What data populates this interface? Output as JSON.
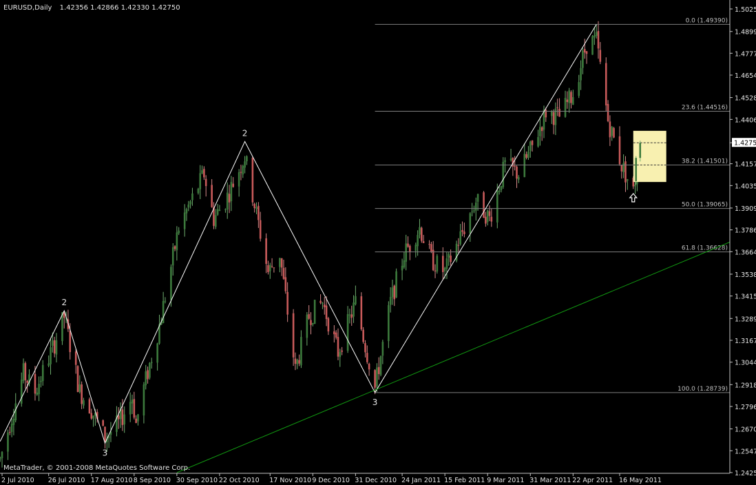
{
  "chart_data": {
    "type": "candlestick",
    "header": {
      "symbol": "EURUSD,Daily",
      "ohlc": "1.42356 1.42866 1.42330 1.42750"
    },
    "copyright": "MetaTrader, © 2001-2008 MetaQuotes Software Corp.",
    "ylim": [
      1.2425,
      1.5055
    ],
    "y_ticks": [
      "1.50255",
      "1.48990",
      "1.47770",
      "1.46545",
      "1.45285",
      "1.44060",
      "1.42750",
      "1.41575",
      "1.40350",
      "1.39090",
      "1.37865",
      "1.36640",
      "1.35380",
      "1.34155",
      "1.32895",
      "1.31670",
      "1.30445",
      "1.29185",
      "1.27960",
      "1.26700",
      "1.25475",
      "1.24250"
    ],
    "current_price": "1.42750",
    "x_ticks": [
      "2 Jul 2010",
      "26 Jul 2010",
      "17 Aug 2010",
      "8 Sep 2010",
      "30 Sep 2010",
      "22 Oct 2010",
      "17 Nov 2010",
      "9 Dec 2010",
      "31 Dec 2010",
      "24 Jan 2011",
      "15 Feb 2011",
      "9 Mar 2011",
      "31 Mar 2011",
      "22 Apr 2011",
      "16 May 2011"
    ],
    "fib_levels": [
      {
        "label": "0.0 (1.49390)",
        "value": 1.4939
      },
      {
        "label": "23.6 (1.44516)",
        "value": 1.44516
      },
      {
        "label": "38.2 (1.41501)",
        "value": 1.41501
      },
      {
        "label": "50.0 (1.39065)",
        "value": 1.39065
      },
      {
        "label": "61.8 (1.36628)",
        "value": 1.36628
      },
      {
        "label": "100.0 (1.28739)",
        "value": 1.28739
      }
    ],
    "zigzag": [
      {
        "date": "2010-07-01",
        "price": 1.26
      },
      {
        "date": "2010-08-03",
        "price": 1.3333
      },
      {
        "date": "2010-08-24",
        "price": 1.259
      },
      {
        "date": "2010-11-04",
        "price": 1.4282
      },
      {
        "date": "2011-01-10",
        "price": 1.2874
      },
      {
        "date": "2011-05-04",
        "price": 1.4939
      }
    ],
    "wave_labels": [
      {
        "text": "2",
        "date": "2010-08-03",
        "price": 1.3333,
        "pos": "above"
      },
      {
        "text": "3",
        "date": "2010-08-24",
        "price": 1.259,
        "pos": "below"
      },
      {
        "text": "2",
        "date": "2010-11-04",
        "price": 1.4282,
        "pos": "above"
      },
      {
        "text": "3",
        "date": "2011-01-10",
        "price": 1.2874,
        "pos": "below"
      }
    ],
    "trendline": {
      "from": {
        "date": "2010-09-30",
        "price": 1.2425
      },
      "to": {
        "date": "2011-06-14",
        "price": 1.3718
      }
    },
    "highlight_box": {
      "from_date": "2011-05-23",
      "to_date": "2011-06-09",
      "top": 1.4342,
      "bottom": 1.4055
    },
    "arrow": {
      "date": "2011-05-23",
      "price": 1.399
    },
    "candle_anchors": [
      {
        "date": "2010-07-01",
        "price": 1.25
      },
      {
        "date": "2010-07-13",
        "price": 1.298
      },
      {
        "date": "2010-07-19",
        "price": 1.288
      },
      {
        "date": "2010-07-29",
        "price": 1.315
      },
      {
        "date": "2010-08-03",
        "price": 1.33
      },
      {
        "date": "2010-08-11",
        "price": 1.288
      },
      {
        "date": "2010-08-16",
        "price": 1.28
      },
      {
        "date": "2010-08-24",
        "price": 1.262
      },
      {
        "date": "2010-08-31",
        "price": 1.27
      },
      {
        "date": "2010-09-07",
        "price": 1.285
      },
      {
        "date": "2010-09-09",
        "price": 1.27
      },
      {
        "date": "2010-09-13",
        "price": 1.29
      },
      {
        "date": "2010-09-21",
        "price": 1.325
      },
      {
        "date": "2010-10-01",
        "price": 1.38
      },
      {
        "date": "2010-10-14",
        "price": 1.41
      },
      {
        "date": "2010-10-19",
        "price": 1.385
      },
      {
        "date": "2010-10-25",
        "price": 1.395
      },
      {
        "date": "2010-11-04",
        "price": 1.42
      },
      {
        "date": "2010-11-16",
        "price": 1.355
      },
      {
        "date": "2010-11-22",
        "price": 1.365
      },
      {
        "date": "2010-11-30",
        "price": 1.3
      },
      {
        "date": "2010-12-07",
        "price": 1.33
      },
      {
        "date": "2010-12-14",
        "price": 1.338
      },
      {
        "date": "2010-12-22",
        "price": 1.31
      },
      {
        "date": "2010-12-31",
        "price": 1.338
      },
      {
        "date": "2011-01-10",
        "price": 1.29
      },
      {
        "date": "2011-01-18",
        "price": 1.338
      },
      {
        "date": "2011-01-25",
        "price": 1.365
      },
      {
        "date": "2011-02-02",
        "price": 1.38
      },
      {
        "date": "2011-02-08",
        "price": 1.362
      },
      {
        "date": "2011-02-15",
        "price": 1.355
      },
      {
        "date": "2011-02-25",
        "price": 1.38
      },
      {
        "date": "2011-03-03",
        "price": 1.395
      },
      {
        "date": "2011-03-10",
        "price": 1.385
      },
      {
        "date": "2011-03-18",
        "price": 1.415
      },
      {
        "date": "2011-03-25",
        "price": 1.41
      },
      {
        "date": "2011-04-01",
        "price": 1.425
      },
      {
        "date": "2011-04-08",
        "price": 1.445
      },
      {
        "date": "2011-04-15",
        "price": 1.442
      },
      {
        "date": "2011-04-22",
        "price": 1.455
      },
      {
        "date": "2011-04-29",
        "price": 1.483
      },
      {
        "date": "2011-05-04",
        "price": 1.485
      },
      {
        "date": "2011-05-10",
        "price": 1.44
      },
      {
        "date": "2011-05-17",
        "price": 1.415
      },
      {
        "date": "2011-05-23",
        "price": 1.4
      },
      {
        "date": "2011-05-27",
        "price": 1.4275
      }
    ],
    "colors": {
      "background": "#000000",
      "up_candle": "#3c7a3c",
      "down_candle": "#c85a5a",
      "wick": "#bbbbbb",
      "grid_text": "#e6e6e6",
      "fib_line": "#7f7f7f",
      "fib_text": "#c0c0c0",
      "zigzag": "#ffffff",
      "trendline": "#119911",
      "highlight_box": "#f8f0b0",
      "current_price_bg": "#ffffff"
    }
  }
}
